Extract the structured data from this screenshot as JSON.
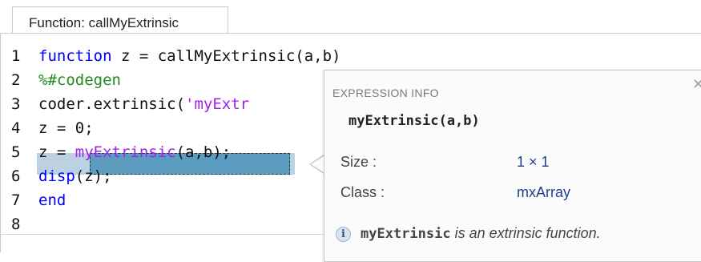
{
  "tab": {
    "label": "Function: callMyExtrinsic"
  },
  "code_lines": [
    {
      "num": "1",
      "segments": [
        {
          "text": "function",
          "style": "keyword"
        },
        {
          "text": " z = callMyExtrinsic(a,b)",
          "style": "plain"
        }
      ]
    },
    {
      "num": "2",
      "segments": [
        {
          "text": "%#codegen",
          "style": "comment"
        }
      ]
    },
    {
      "num": "3",
      "segments": [
        {
          "text": "coder.extrinsic(",
          "style": "plain"
        },
        {
          "text": "'myExtr",
          "style": "string"
        }
      ]
    },
    {
      "num": "4",
      "segments": [
        {
          "text": "z = 0;",
          "style": "plain"
        }
      ]
    },
    {
      "num": "5",
      "segments": [
        {
          "text": "z = ",
          "style": "plain"
        },
        {
          "text": "myExtrinsic",
          "style": "string"
        },
        {
          "text": "(a,b);",
          "style": "plain"
        }
      ]
    },
    {
      "num": "6",
      "segments": [
        {
          "text": "disp",
          "style": "keyword"
        },
        {
          "text": "(z);",
          "style": "plain"
        }
      ]
    },
    {
      "num": "7",
      "segments": [
        {
          "text": "end",
          "style": "keyword"
        }
      ]
    },
    {
      "num": "8",
      "segments": []
    }
  ],
  "popup": {
    "header": "EXPRESSION INFO",
    "close_icon": "close-icon",
    "expression": "myExtrinsic(a,b)",
    "size_label": "Size :",
    "size_value": "1 × 1",
    "class_label": "Class :",
    "class_value": "mxArray",
    "info_icon": "info-icon",
    "info_function": "myExtrinsic",
    "info_text": " is an extrinsic function."
  },
  "colors": {
    "keyword": "#0000ff",
    "comment": "#228b22",
    "string": "#a020f0",
    "selection_line": "#bcd2e2",
    "selection_token": "#5c9cc0"
  }
}
